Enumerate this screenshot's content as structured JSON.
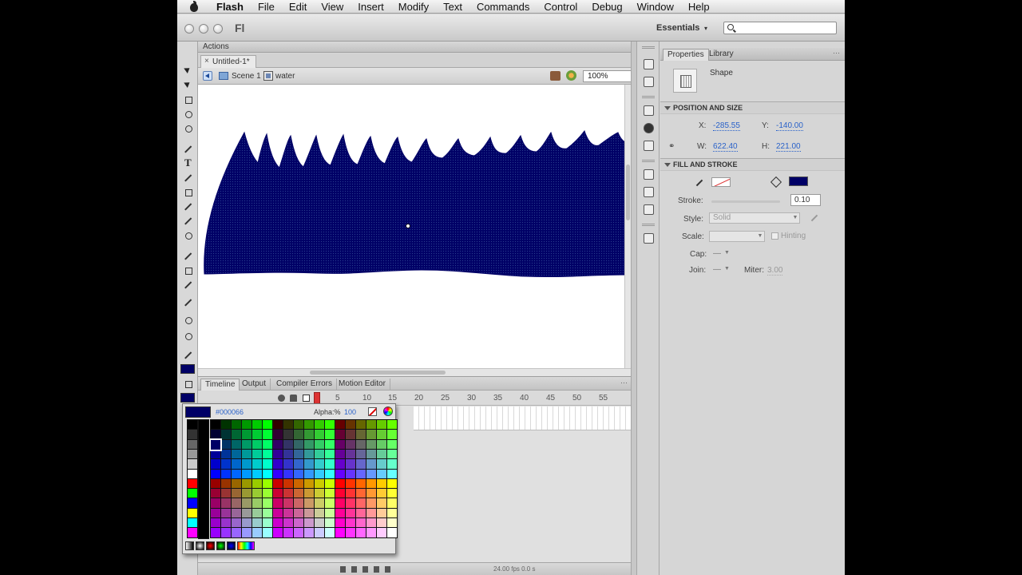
{
  "menubar": {
    "app_name": "Flash",
    "items": [
      "File",
      "Edit",
      "View",
      "Insert",
      "Modify",
      "Text",
      "Commands",
      "Control",
      "Debug",
      "Window",
      "Help"
    ]
  },
  "appbar": {
    "logo": "Fl",
    "workspace": "Essentials",
    "workspace_arrow": "▾"
  },
  "actions_panel": {
    "label": "Actions"
  },
  "document": {
    "tab_title": "Untitled-1*",
    "close": "×"
  },
  "editbar": {
    "scene": "Scene 1",
    "symbol": "water",
    "zoom": "100%"
  },
  "stage": {
    "shape_fill": "#000066",
    "background": "#ffffff"
  },
  "timeline": {
    "tabs": [
      "Timeline",
      "Output",
      "Compiler Errors",
      "Motion Editor"
    ],
    "frame_numbers": [
      "5",
      "10",
      "15",
      "20",
      "25",
      "30",
      "35",
      "40",
      "45",
      "50",
      "55"
    ],
    "fps": "24.00 fps   0.0 s",
    "current_frame": "1"
  },
  "color_picker": {
    "hex": "#000066",
    "alpha_label": "Alpha:%",
    "alpha_value": "100",
    "selected": "#000066"
  },
  "properties": {
    "tabs": [
      "Properties",
      "Library"
    ],
    "object_type": "Shape",
    "position_size": {
      "section": "POSITION AND SIZE",
      "x_label": "X:",
      "x": "-285.55",
      "y_label": "Y:",
      "y": "-140.00",
      "w_label": "W:",
      "w": "622.40",
      "h_label": "H:",
      "h": "221.00"
    },
    "fill_stroke": {
      "section": "FILL AND STROKE",
      "fill_color": "#000066",
      "stroke_label": "Stroke:",
      "stroke": "0.10",
      "style_label": "Style:",
      "style": "Solid",
      "scale_label": "Scale:",
      "scale": "",
      "hinting_label": "Hinting",
      "cap_label": "Cap:",
      "cap": "—",
      "join_label": "Join:",
      "join": "—",
      "miter_label": "Miter:",
      "miter": "3.00"
    }
  }
}
